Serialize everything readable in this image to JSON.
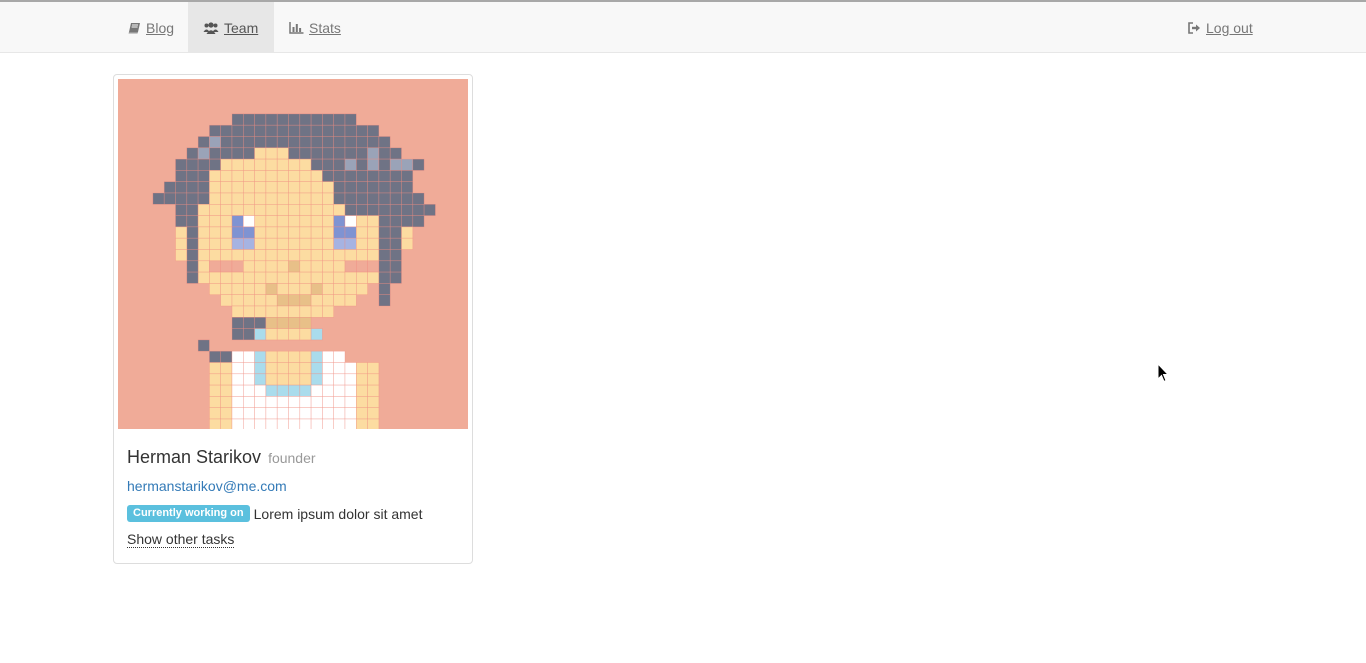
{
  "nav": {
    "items": [
      {
        "label": "Blog",
        "icon": "book-icon",
        "active": false
      },
      {
        "label": "Team",
        "icon": "users-icon",
        "active": true
      },
      {
        "label": "Stats",
        "icon": "bar-chart-icon",
        "active": false
      }
    ],
    "logout": {
      "label": "Log out",
      "icon": "sign-out-icon"
    }
  },
  "member": {
    "name": "Herman Starikov",
    "role": "founder",
    "email": "hermanstarikov@me.com",
    "badge": "Currently working on",
    "task": "Lorem ipsum dolor sit amet",
    "show_tasks_label": "Show other tasks"
  },
  "colors": {
    "avatar_bg": "#f0ab98",
    "link": "#337ab7",
    "badge": "#5bc0de",
    "hair": "#6f7385",
    "skin": "#fcdca1"
  }
}
